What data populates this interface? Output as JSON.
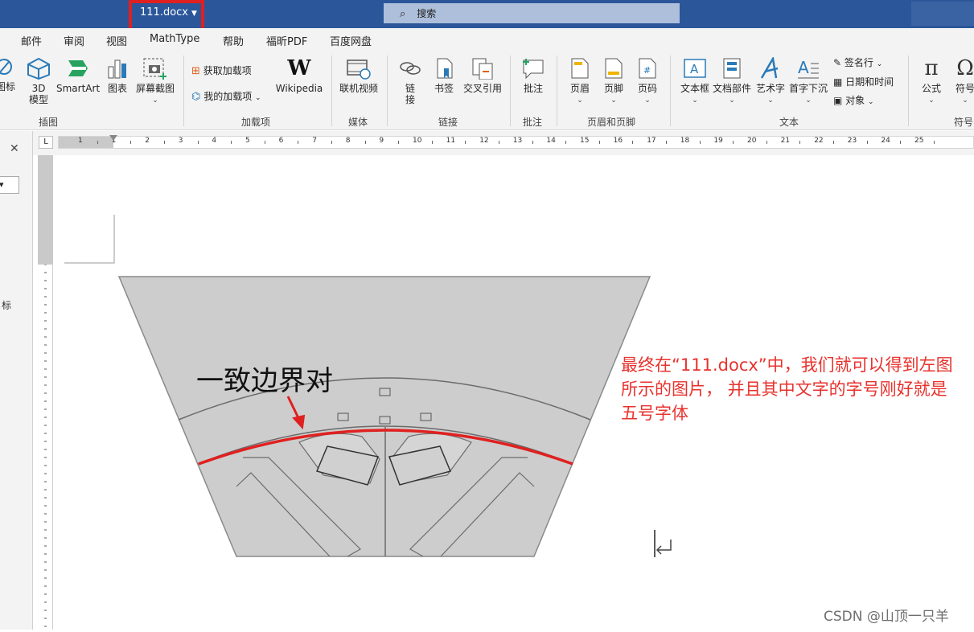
{
  "titlebar": {
    "doc_name": "111.docx",
    "search_label": "搜索"
  },
  "menu": [
    "邮件",
    "审阅",
    "视图",
    "MathType",
    "帮助",
    "福昕PDF",
    "百度网盘"
  ],
  "ribbon": {
    "illustrations": {
      "icons_label": "图标",
      "model3d_label": "3D\n模型",
      "smartart_label": "SmartArt",
      "chart_label": "图表",
      "screenshot_label": "屏幕截图",
      "group": "插图"
    },
    "addins": {
      "get_label": "获取加载项",
      "my_label": "我的加载项",
      "wiki_label": "Wikipedia",
      "group": "加载项"
    },
    "media": {
      "video_label": "联机视频",
      "group": "媒体"
    },
    "links": {
      "link_label": "链\n接",
      "bookmark_label": "书签",
      "crossref_label": "交叉引用",
      "group": "链接"
    },
    "comments": {
      "comment_label": "批注",
      "group": "批注"
    },
    "headerfooter": {
      "header_label": "页眉",
      "footer_label": "页脚",
      "pagenum_label": "页码",
      "group": "页眉和页脚"
    },
    "text": {
      "textbox_label": "文本框",
      "quickparts_label": "文档部件",
      "wordart_label": "艺术字",
      "dropcap_label": "首字下沉",
      "sigline_label": "签名行",
      "datetime_label": "日期和时间",
      "object_label": "对象",
      "group": "文本"
    },
    "symbols": {
      "equation_label": "公式",
      "symbol_label": "符号",
      "group": "符号"
    }
  },
  "left_panel": {
    "text": "标"
  },
  "ruler_numbers": [
    "1",
    "1",
    "2",
    "3",
    "4",
    "5",
    "6",
    "7",
    "8",
    "9",
    "10",
    "11",
    "12",
    "13",
    "14",
    "15",
    "16",
    "17",
    "18",
    "19",
    "20",
    "21",
    "22",
    "23",
    "24",
    "25"
  ],
  "ruler_tab_glyph": "L",
  "figure": {
    "label": "一致边界对"
  },
  "note": {
    "text": "最终在“111.docx”中，我们就可以得到左图所示的图片，  并且其中文字的字号刚好就是五号字体"
  },
  "watermark": "CSDN @山顶一只羊",
  "colors": {
    "titlebar": "#2b579a",
    "highlight": "#e02020",
    "note": "#e8322d"
  }
}
